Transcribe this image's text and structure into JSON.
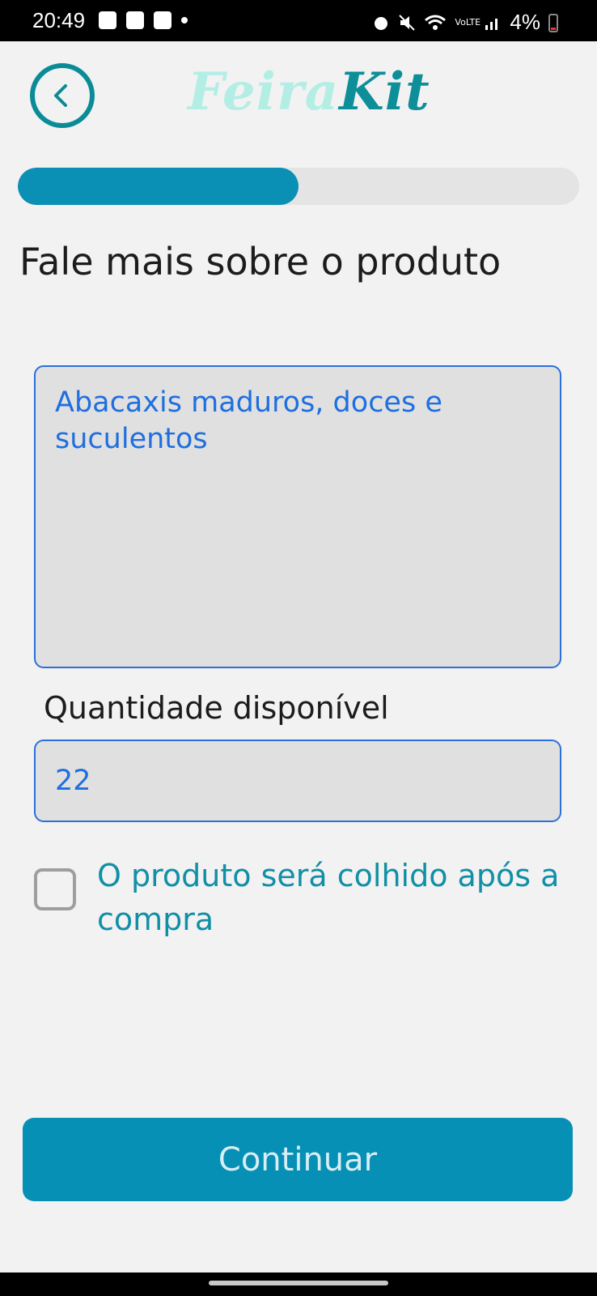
{
  "status_bar": {
    "time": "20:49",
    "battery": "4%",
    "network": "VoLTE"
  },
  "header": {
    "logo_part1": "Feira",
    "logo_part2": "Kit",
    "colors": {
      "accent": "#0b8b96",
      "logo_light": "#b3eee5",
      "logo_dark": "#0e8e99"
    }
  },
  "progress": {
    "value_percent": 50,
    "color": "#0a8fb5"
  },
  "form": {
    "title": "Fale mais sobre o produto",
    "description_value": "Abacaxis maduros, doces e suculentos",
    "quantity_label": "Quantidade disponível",
    "quantity_value": "22",
    "harvest_checkbox_label": "O produto será colhido após a compra",
    "harvest_checked": false
  },
  "actions": {
    "continue_label": "Continuar",
    "button_color": "#0790b5"
  }
}
